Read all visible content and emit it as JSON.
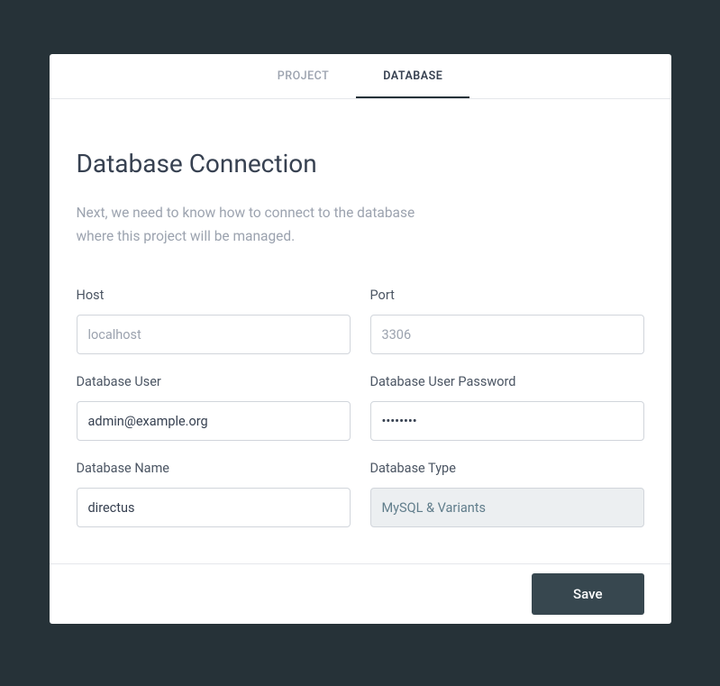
{
  "tabs": {
    "project": "PROJECT",
    "database": "DATABASE"
  },
  "title": "Database Connection",
  "subtitle": "Next, we need to know how to connect to the database where this project will be managed.",
  "form": {
    "host": {
      "label": "Host",
      "placeholder": "localhost",
      "value": ""
    },
    "port": {
      "label": "Port",
      "placeholder": "3306",
      "value": ""
    },
    "user": {
      "label": "Database User",
      "value": "admin@example.org"
    },
    "password": {
      "label": "Database User Password",
      "value": "••••••••"
    },
    "name": {
      "label": "Database Name",
      "value": "directus"
    },
    "type": {
      "label": "Database Type",
      "value": "MySQL & Variants"
    }
  },
  "footer": {
    "save_label": "Save"
  }
}
